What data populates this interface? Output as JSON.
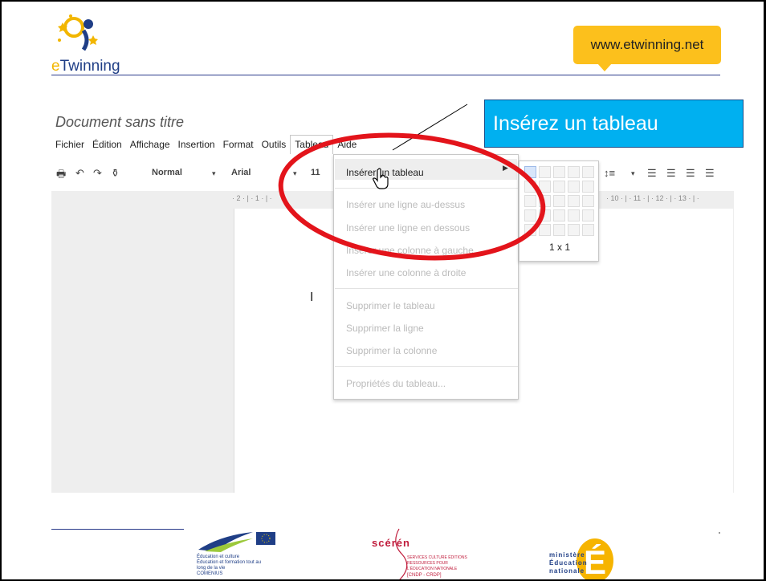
{
  "header": {
    "logo_text_e": "e",
    "logo_text_rest": "Twinning",
    "url": "www.etwinning.net"
  },
  "doc": {
    "title": "Document sans titre",
    "menu": [
      "Fichier",
      "Édition",
      "Affichage",
      "Insertion",
      "Format",
      "Outils",
      "Tableau",
      "Aide"
    ],
    "open_menu": "Tableau",
    "toolbar": {
      "style": "Normal",
      "font": "Arial",
      "size": "11"
    },
    "ruler_text": "· 2 · | · 1 · | ·",
    "ruler_text_right": "· 10 · | · 11 · | · 12 · | · 13 · | ·"
  },
  "dropdown": {
    "items": [
      {
        "label": "Insérer un tableau",
        "enabled": true,
        "submenu": true
      },
      {
        "label": "Insérer une ligne au-dessus",
        "enabled": false
      },
      {
        "label": "Insérer une ligne en dessous",
        "enabled": false
      },
      {
        "label": "Insérer une colonne à gauche",
        "enabled": false
      },
      {
        "label": "Insérer une colonne à droite",
        "enabled": false
      },
      {
        "label": "Supprimer le tableau",
        "enabled": false
      },
      {
        "label": "Supprimer la ligne",
        "enabled": false
      },
      {
        "label": "Supprimer la colonne",
        "enabled": false
      },
      {
        "label": "Propriétés du tableau...",
        "enabled": false
      }
    ],
    "grid_label": "1 x 1",
    "grid_rows": 5,
    "grid_cols": 5
  },
  "callout": {
    "text": "Insérez un tableau"
  },
  "footer": {
    "eu_lines": [
      "Éducation et culture",
      "Éducation et formation tout au",
      "long de la vie",
      "COMENIUS"
    ],
    "sceren": "scérén",
    "sceren_lines": [
      "SERVICES CULTURE ÉDITIONS",
      "RESSOURCES POUR",
      "L'ÉDUCATION NATIONALE",
      "[CNDP - CRDP]"
    ],
    "ministere_lines": [
      "ministère",
      "Éducation",
      "nationale"
    ],
    "ministere_letter": "É"
  },
  "colors": {
    "callout_bg": "#00b0f0",
    "ellipse": "#e3141b",
    "url_bubble": "#fcc01c",
    "brand_blue": "#1f3e86"
  }
}
